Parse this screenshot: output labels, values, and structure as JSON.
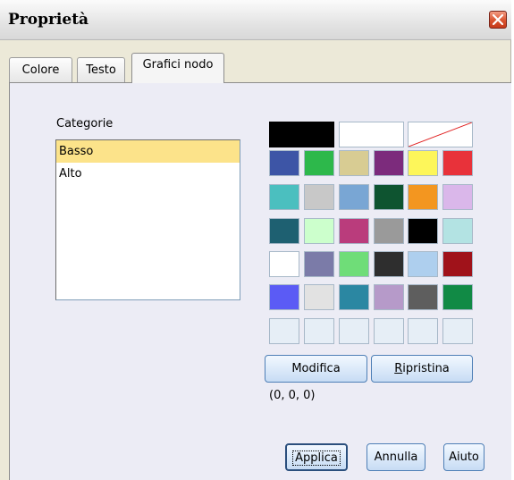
{
  "window": {
    "title": "Proprietà"
  },
  "tabs": [
    {
      "label": "Colore",
      "active": false
    },
    {
      "label": "Testo",
      "active": false
    },
    {
      "label": "Grafici nodo",
      "active": true
    }
  ],
  "categories": {
    "label": "Categorie",
    "items": [
      {
        "label": "Basso",
        "selected": true
      },
      {
        "label": "Alto",
        "selected": false
      }
    ]
  },
  "palette": {
    "top_row": [
      "#000000",
      "#ffffff",
      "none-slash"
    ],
    "grid": [
      [
        "#3d55a6",
        "#2db84b",
        "#d8cc93",
        "#7c2b7c",
        "#fdf65a",
        "#e8323a"
      ],
      [
        "#4bbfbf",
        "#c8c8c8",
        "#79a6d4",
        "#0e5430",
        "#f39620",
        "#dab7ea"
      ],
      [
        "#1e6071",
        "#ccffcc",
        "#ba3c7c",
        "#9a9a9a",
        "#000000",
        "#b3e3e3"
      ],
      [
        "#ffffff",
        "#7b7ba8",
        "#6fdd78",
        "#2e2e2e",
        "#aecfee",
        "#a0121a"
      ],
      [
        "#5b5bf5",
        "#e2e2e2",
        "#2b87a2",
        "#b69ac9",
        "#5e5e5e",
        "#118a45"
      ],
      [
        "#e6eef6",
        "#e6eef6",
        "#e6eef6",
        "#e6eef6",
        "#e6eef6",
        "#e6eef6"
      ]
    ]
  },
  "buttons": {
    "modifica": "Modifica",
    "ripristina_mnemonic": "R",
    "ripristina_rest": "ipristina",
    "applica": "Applica",
    "annulla": "Annulla",
    "aiuto": "Aiuto"
  },
  "rgb_value": "(0, 0, 0)",
  "icons": {
    "close": "close-icon"
  }
}
